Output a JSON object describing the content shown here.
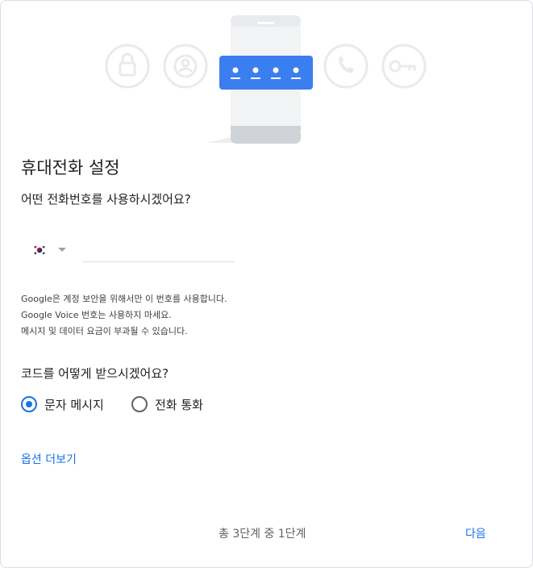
{
  "title": "휴대전화 설정",
  "phone_question": "어떤 전화번호를 사용하시겠어요?",
  "phone_input": {
    "value": "",
    "placeholder": "",
    "country_flag": "korea-flag-icon"
  },
  "notice": [
    "Google은 계정 보안을 위해서만 이 번호를 사용합니다.",
    "Google Voice 번호는 사용하지 마세요.",
    "메시지 및 데이터 요금이 부과될 수 있습니다."
  ],
  "code_question": "코드를 어떻게 받으시겠어요?",
  "options": [
    {
      "label": "문자 메시지",
      "selected": true
    },
    {
      "label": "전화 통화",
      "selected": false
    }
  ],
  "more_options": "옵션 더보기",
  "step_text": "총 3단계 중 1단계",
  "next_label": "다음",
  "colors": {
    "accent": "#1a73e8",
    "illustration_blue": "#3b7ef0",
    "radio_checked": "#1a73e8",
    "muted": "#dadce0"
  }
}
